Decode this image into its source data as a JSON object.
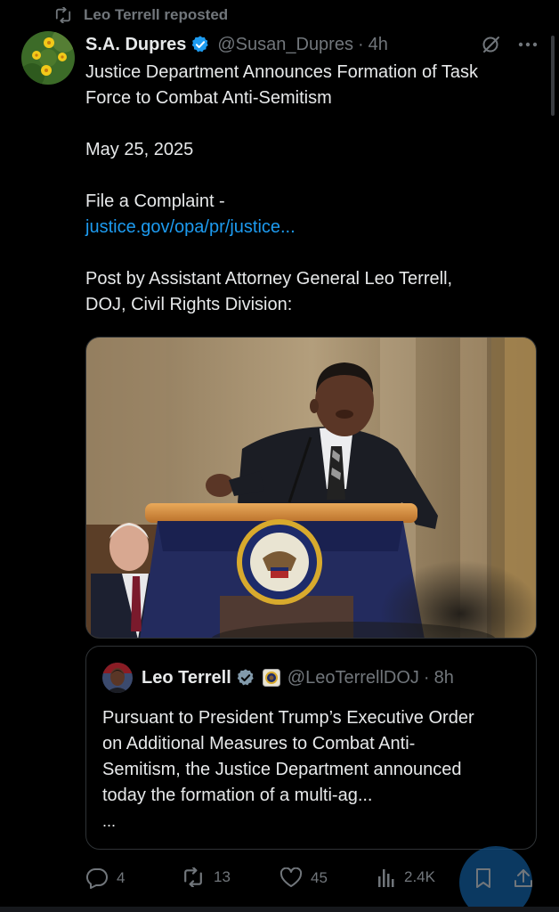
{
  "repost": {
    "label": "Leo Terrell reposted",
    "icon": "repost-icon"
  },
  "post": {
    "display_name": "S.A. Dupres",
    "handle": "@Susan_Dupres",
    "separator": "·",
    "time": "4h",
    "text_lines": [
      "Justice Department Announces Formation of Task",
      "Force to Combat Anti-Semitism",
      "",
      "May 25, 2025",
      "",
      "File a Complaint -"
    ],
    "link": "justice.gov/opa/pr/justice...",
    "text_lines_2": [
      "",
      "Post by Assistant Attorney General Leo Terrell,",
      "DOJ, Civil Rights Division:"
    ],
    "photo_seal_text": "DEPARTMENT OF JUSTICE"
  },
  "quote": {
    "display_name": "Leo Terrell",
    "handle": "@LeoTerrellDOJ",
    "separator": "·",
    "time": "8h",
    "text_lines": [
      "Pursuant to President Trump’s Executive Order",
      "on Additional Measures to Combat Anti-",
      "Semitism, the Justice Department announced",
      "today the formation of a multi-ag..."
    ],
    "more": "..."
  },
  "actions": {
    "replies": "4",
    "reposts": "13",
    "likes": "45",
    "views": "2.4K"
  },
  "colors": {
    "accent": "#1d9bf0",
    "secondary_text": "#71767b",
    "background": "#000000",
    "border": "#2f3336"
  }
}
